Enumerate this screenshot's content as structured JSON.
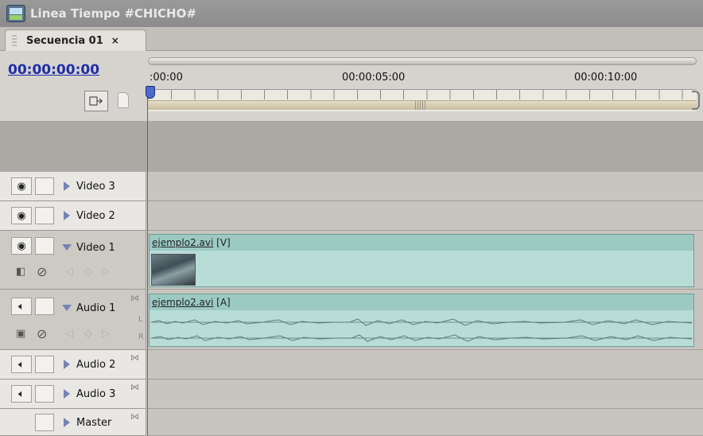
{
  "window": {
    "title": "Linea Tiempo #CHICHO#"
  },
  "tab": {
    "label": "Secuencia 01",
    "close": "×"
  },
  "timecode": "00:00:00:00",
  "ruler": {
    "labels": [
      ":00:00",
      "00:00:05:00",
      "00:00:10:00"
    ]
  },
  "tracks": {
    "video3": {
      "name": "Video 3"
    },
    "video2": {
      "name": "Video 2"
    },
    "video1": {
      "name": "Video 1",
      "clip": {
        "file": "ejemplo2.avi",
        "tag": "[V]"
      }
    },
    "audio1": {
      "name": "Audio 1",
      "clip": {
        "file": "ejemplo2.avi",
        "tag": "[A]"
      },
      "channels": [
        "L",
        "R"
      ]
    },
    "audio2": {
      "name": "Audio 2"
    },
    "audio3": {
      "name": "Audio 3"
    },
    "master": {
      "name": "Master"
    }
  },
  "colors": {
    "timecode": "#1e2ea8",
    "playhead": "#c83a2c",
    "clip": "#b8dcd6",
    "clip_header": "#9ccac3"
  },
  "icons": [
    "eye-icon",
    "speaker-icon",
    "lock-icon",
    "expand-triangle-icon",
    "snap-icon",
    "set-marker-icon",
    "close-icon"
  ]
}
